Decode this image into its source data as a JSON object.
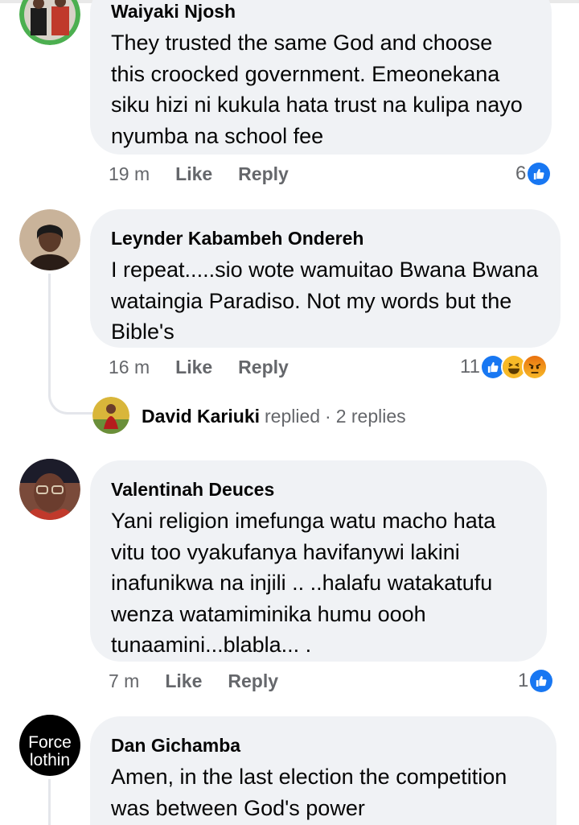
{
  "comments": [
    {
      "author": "Waiyaki Njosh",
      "text": "They trusted the same God and choose this croocked government. Emeonekana siku hizi ni kukula hata trust na kulipa nayo nyumba na school fee",
      "time": "19 m",
      "like_label": "Like",
      "reply_label": "Reply",
      "reaction_count": "6",
      "reactions": [
        "like-icon"
      ]
    },
    {
      "author": "Leynder Kabambeh Ondereh",
      "text": "I repeat.....sio wote wamuitao Bwana Bwana wataingia Paradiso. Not my words but the Bible's",
      "time": "16 m",
      "like_label": "Like",
      "reply_label": "Reply",
      "reaction_count": "11",
      "reactions": [
        "like-icon",
        "haha-icon",
        "angry-icon"
      ],
      "replies_summary": {
        "name": "David Kariuki",
        "verb": "replied",
        "dot": "·",
        "count_label": "2 replies"
      }
    },
    {
      "author": "Valentinah Deuces",
      "text": "Yani religion imefunga watu macho hata vitu too vyakufanya havifanywi lakini inafunikwa na injili .. ..halafu watakatufu wenza watamiminika humu oooh tunaamini...blabla... .",
      "time": "7 m",
      "like_label": "Like",
      "reply_label": "Reply",
      "reaction_count": "1",
      "reactions": [
        "like-icon"
      ]
    },
    {
      "author": "Dan Gichamba",
      "text": "Amen, in the last election the competition was between God's power",
      "avatar_text_line1": "Force",
      "avatar_text_line2": "lothin"
    }
  ],
  "colors": {
    "bubble": "#f0f2f5",
    "meta": "#65676b",
    "like_blue": "#1877f2",
    "haha_yellow": "#f7b928",
    "angry_orange": "#e9710f"
  }
}
